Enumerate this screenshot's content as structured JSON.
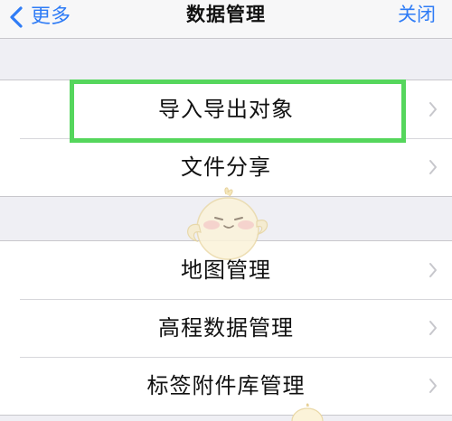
{
  "nav": {
    "back_label": "更多",
    "title": "数据管理",
    "close_label": "关闭"
  },
  "groups": [
    {
      "items": [
        {
          "label": "导入导出对象"
        },
        {
          "label": "文件分享"
        }
      ]
    },
    {
      "items": [
        {
          "label": "地图管理"
        },
        {
          "label": "高程数据管理"
        },
        {
          "label": "标签附件库管理"
        }
      ]
    }
  ],
  "colors": {
    "accent": "#2f7cf6",
    "highlight": "#55d65c",
    "background": "#efeff4",
    "separator": "#c8c7cc"
  },
  "icons": {
    "back": "chevron-left-icon",
    "disclosure": "chevron-right-icon",
    "watermark": "chick-mascot-icon"
  }
}
